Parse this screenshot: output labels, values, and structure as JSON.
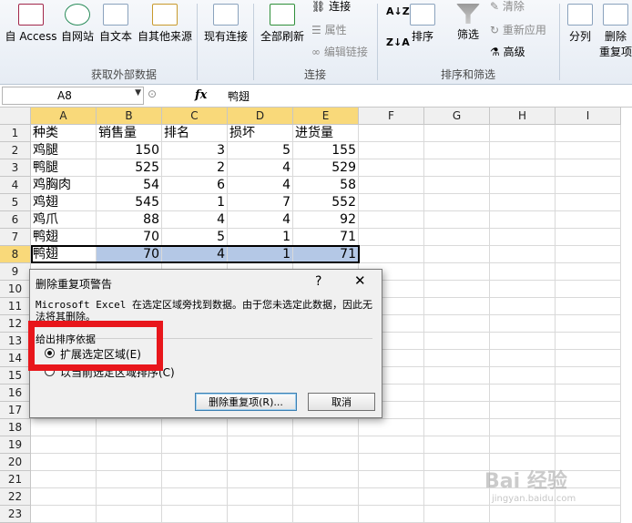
{
  "ribbon": {
    "get_external": {
      "buttons": [
        "自 Access",
        "自网站",
        "自文本",
        "自其他来源",
        "现有连接"
      ],
      "label": "获取外部数据"
    },
    "connections": {
      "refresh_all": "全部刷新",
      "connect": "连接",
      "properties": "属性",
      "edit_links": "编辑链接",
      "label": "连接"
    },
    "sort_filter": {
      "sort": "排序",
      "filter": "筛选",
      "clear": "清除",
      "reapply": "重新应用",
      "advanced": "高级",
      "label": "排序和筛选"
    },
    "tools": {
      "split": "分列",
      "remove": "删除",
      "remove2": "重复项"
    }
  },
  "formula_bar": {
    "name_box": "A8",
    "fx": "fx",
    "value": "鸭翅"
  },
  "columns": [
    "A",
    "B",
    "C",
    "D",
    "E",
    "F",
    "G",
    "H",
    "I"
  ],
  "rows": [
    "1",
    "2",
    "3",
    "4",
    "5",
    "6",
    "7",
    "8",
    "9",
    "10",
    "11",
    "12",
    "13",
    "14",
    "15",
    "16",
    "17",
    "18",
    "19",
    "20",
    "21",
    "22",
    "23"
  ],
  "table": {
    "headers": [
      "种类",
      "销售量",
      "排名",
      "损坏",
      "进货量"
    ],
    "data": [
      [
        "鸡腿",
        "150",
        "3",
        "5",
        "155"
      ],
      [
        "鸭腿",
        "525",
        "2",
        "4",
        "529"
      ],
      [
        "鸡胸肉",
        "54",
        "6",
        "4",
        "58"
      ],
      [
        "鸡翅",
        "545",
        "1",
        "7",
        "552"
      ],
      [
        "鸡爪",
        "88",
        "4",
        "4",
        "92"
      ],
      [
        "鸭翅",
        "70",
        "5",
        "1",
        "71"
      ],
      [
        "鸭翅",
        "70",
        "4",
        "1",
        "71"
      ]
    ]
  },
  "dialog": {
    "title": "删除重复项警告",
    "help": "?",
    "close": "✕",
    "message": "Microsoft Excel 在选定区域旁找到数据。由于您未选定此数据，因此无法将其删除。",
    "section": "给出排序依据",
    "option1": "扩展选定区域(E)",
    "option2": "以当前选定区域排序(C)",
    "ok_button": "删除重复项(R)...",
    "cancel_button": "取消"
  },
  "watermark": {
    "text": "Bai 经验",
    "sub": "jingyan.baidu.com"
  }
}
